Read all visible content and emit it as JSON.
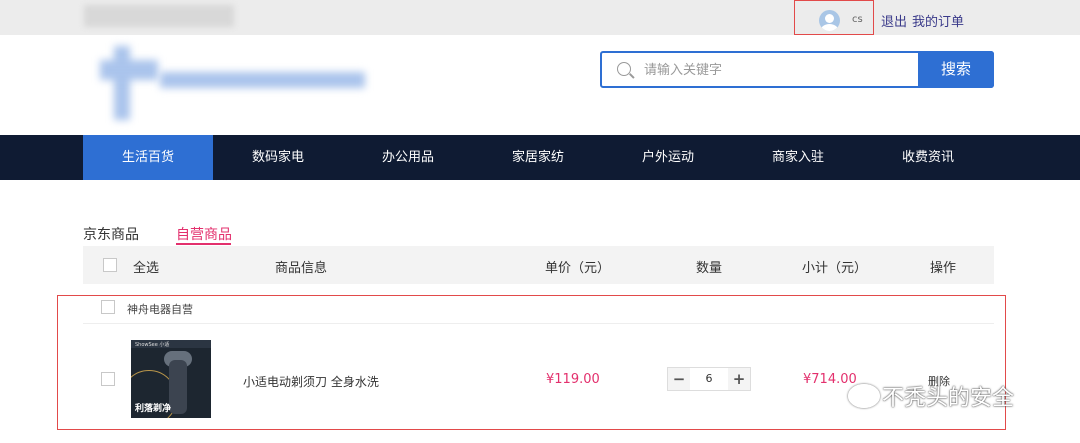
{
  "header": {
    "username": "cs",
    "logout_label": "退出",
    "orders_label": "我的订单"
  },
  "search": {
    "placeholder": "请输入关键字",
    "button_label": "搜索"
  },
  "nav": {
    "items": [
      "生活百货",
      "数码家电",
      "办公用品",
      "家居家纺",
      "户外运动",
      "商家入驻",
      "收费资讯"
    ],
    "active_index": 0
  },
  "tabs": [
    "京东商品",
    "自营商品"
  ],
  "table": {
    "headers": {
      "select_all": "全选",
      "product_info": "商品信息",
      "unit_price": "单价（元）",
      "quantity": "数量",
      "subtotal": "小计（元）",
      "actions": "操作"
    }
  },
  "shop": {
    "name": "神舟电器自营"
  },
  "cart_item": {
    "image_brand": "ShowSee 小适",
    "image_caption": "利落剃净",
    "name": "小适电动剃须刀 全身水洗",
    "price": "¥119.00",
    "quantity": "6",
    "subtotal": "¥714.00",
    "delete_label": "删除"
  },
  "watermark": "不秃头的安全",
  "colors": {
    "accent": "#2e6fd3",
    "nav_bg": "#0f1b33",
    "price": "#e3306d",
    "highlight": "#e24a4a"
  }
}
